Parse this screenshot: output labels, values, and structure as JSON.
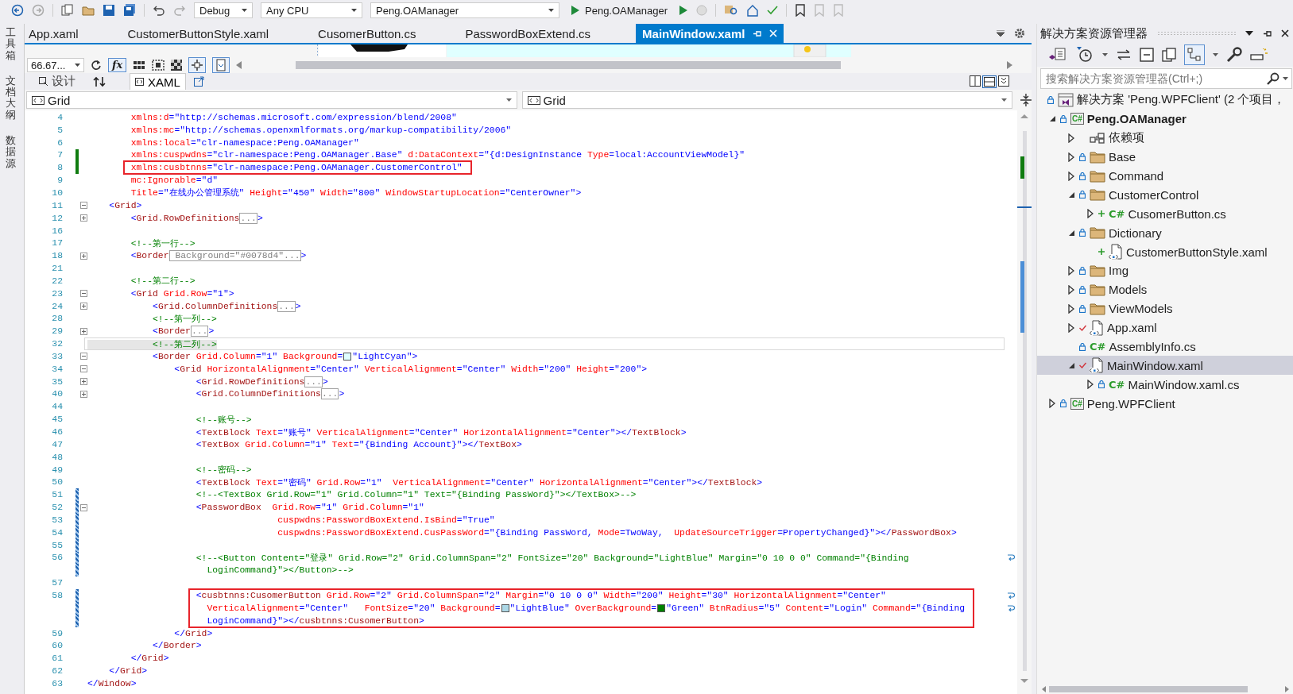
{
  "toolbar": {
    "configuration": "Debug",
    "platform": "Any CPU",
    "startup_project": "Peng.OAManager",
    "run_target": "Peng.OAManager"
  },
  "side_tabs": [
    {
      "label": "工具箱"
    },
    {
      "label": "文档大纲"
    },
    {
      "label": "数据源"
    }
  ],
  "document_tabs": [
    {
      "label": "App.xaml",
      "selected": false
    },
    {
      "label": "CustomerButtonStyle.xaml",
      "selected": false
    },
    {
      "label": "CusomerButton.cs",
      "selected": false
    },
    {
      "label": "PasswordBoxExtend.cs",
      "selected": false
    },
    {
      "label": "MainWindow.xaml",
      "selected": true
    }
  ],
  "designer": {
    "zoom": "66.67...",
    "effects_button": "fx",
    "view_tabs": [
      {
        "label": "设计",
        "selected": false
      },
      {
        "label": "XAML",
        "selected": true
      }
    ],
    "scope_left": "Grid",
    "scope_right": "Grid"
  },
  "code": {
    "rows": [
      {
        "number": "4",
        "tokens": [
          {
            "kind": "attr",
            "text": "        xmlns:d"
          },
          {
            "kind": "val",
            "text": "=\"http://schemas.microsoft.com/expression/blend/2008\""
          }
        ]
      },
      {
        "number": "5",
        "tokens": [
          {
            "kind": "attr",
            "text": "        xmlns:mc"
          },
          {
            "kind": "val",
            "text": "=\"http://schemas.openxmlformats.org/markup-compatibility/2006\""
          }
        ]
      },
      {
        "number": "6",
        "tokens": [
          {
            "kind": "attr",
            "text": "        xmlns:local"
          },
          {
            "kind": "val",
            "text": "=\"clr-namespace:Peng.OAManager\""
          }
        ]
      },
      {
        "number": "7",
        "unsaved_change": true,
        "tokens": [
          {
            "kind": "attr",
            "text": "        xmlns:cuspwdns"
          },
          {
            "kind": "val",
            "text": "=\"clr-namespace:Peng.OAManager.Base\""
          },
          {
            "kind": "attr",
            "text": " d:DataContext"
          },
          {
            "kind": "val",
            "text": "=\"{d:DesignInstance "
          },
          {
            "kind": "attr",
            "text": "Type"
          },
          {
            "kind": "val",
            "text": "=local:AccountViewModel}\""
          }
        ]
      },
      {
        "number": "8",
        "unsaved_change": true,
        "boxed": true,
        "tokens": [
          {
            "kind": "attr",
            "text": "        xmlns:cusbtnns"
          },
          {
            "kind": "val",
            "text": "=\"clr-namespace:Peng.OAManager.CustomerControl\""
          }
        ]
      },
      {
        "number": "9",
        "tokens": [
          {
            "kind": "attr",
            "text": "        mc:Ignorable"
          },
          {
            "kind": "val",
            "text": "=\"d\""
          }
        ]
      },
      {
        "number": "10",
        "tokens": [
          {
            "kind": "attr",
            "text": "        Title"
          },
          {
            "kind": "val",
            "text": "=\"在线办公管理系统\""
          },
          {
            "kind": "attr",
            "text": " Height"
          },
          {
            "kind": "val",
            "text": "=\"450\""
          },
          {
            "kind": "attr",
            "text": " Width"
          },
          {
            "kind": "val",
            "text": "=\"800\""
          },
          {
            "kind": "attr",
            "text": " WindowStartupLocation"
          },
          {
            "kind": "val",
            "text": "=\"CenterOwner\">"
          }
        ]
      },
      {
        "number": "11",
        "folded": false,
        "tokens": [
          {
            "kind": "p",
            "text": "    <"
          },
          {
            "kind": "tag",
            "text": "Grid"
          },
          {
            "kind": "p",
            "text": ">"
          }
        ]
      },
      {
        "number": "12",
        "folded": true,
        "tokens": [
          {
            "kind": "p",
            "text": "        <"
          },
          {
            "kind": "tag",
            "text": "Grid.RowDefinitions"
          },
          {
            "kind": "fold",
            "text": "..."
          },
          {
            "kind": "p",
            "text": ">"
          }
        ]
      },
      {
        "number": "16"
      },
      {
        "number": "17",
        "tokens": [
          {
            "kind": "com",
            "text": "        <!--第一行-->"
          }
        ]
      },
      {
        "number": "18",
        "folded": true,
        "tokens": [
          {
            "kind": "p",
            "text": "        <"
          },
          {
            "kind": "tag",
            "text": "Border"
          },
          {
            "kind": "fold",
            "text": " Background=\"#0078d4\"..."
          },
          {
            "kind": "p",
            "text": ">"
          }
        ]
      },
      {
        "number": "21"
      },
      {
        "number": "22",
        "tokens": [
          {
            "kind": "com",
            "text": "        <!--第二行-->"
          }
        ]
      },
      {
        "number": "23",
        "folded": false,
        "tokens": [
          {
            "kind": "p",
            "text": "        <"
          },
          {
            "kind": "tag",
            "text": "Grid"
          },
          {
            "kind": "attr",
            "text": " Grid.Row"
          },
          {
            "kind": "val",
            "text": "=\"1\">"
          }
        ]
      },
      {
        "number": "24",
        "folded": true,
        "tokens": [
          {
            "kind": "p",
            "text": "            <"
          },
          {
            "kind": "tag",
            "text": "Grid.ColumnDefinitions"
          },
          {
            "kind": "fold",
            "text": "..."
          },
          {
            "kind": "p",
            "text": ">"
          }
        ]
      },
      {
        "number": "28",
        "tokens": [
          {
            "kind": "com",
            "text": "            <!--第一列-->"
          }
        ]
      },
      {
        "number": "29",
        "folded": true,
        "tokens": [
          {
            "kind": "p",
            "text": "            <"
          },
          {
            "kind": "tag",
            "text": "Border"
          },
          {
            "kind": "fold",
            "text": "..."
          },
          {
            "kind": "p",
            "text": ">"
          }
        ]
      },
      {
        "number": "32",
        "current": true,
        "tokens": [
          {
            "kind": "com",
            "text": "            <!--第二列-->"
          }
        ]
      },
      {
        "number": "33",
        "folded": false,
        "tokens": [
          {
            "kind": "p",
            "text": "            <"
          },
          {
            "kind": "tag",
            "text": "Border"
          },
          {
            "kind": "attr",
            "text": " Grid.Column"
          },
          {
            "kind": "val",
            "text": "=\"1\""
          },
          {
            "kind": "attr",
            "text": " Background"
          },
          {
            "kind": "val",
            "text": "="
          },
          {
            "kind": "swatch",
            "color": "#e0ffff"
          },
          {
            "kind": "val",
            "text": "\"LightCyan\">"
          }
        ]
      },
      {
        "number": "34",
        "folded": false,
        "tokens": [
          {
            "kind": "p",
            "text": "                <"
          },
          {
            "kind": "tag",
            "text": "Grid"
          },
          {
            "kind": "attr",
            "text": " HorizontalAlignment"
          },
          {
            "kind": "val",
            "text": "=\"Center\""
          },
          {
            "kind": "attr",
            "text": " VerticalAlignment"
          },
          {
            "kind": "val",
            "text": "=\"Center\""
          },
          {
            "kind": "attr",
            "text": " Width"
          },
          {
            "kind": "val",
            "text": "=\"200\""
          },
          {
            "kind": "attr",
            "text": " Height"
          },
          {
            "kind": "val",
            "text": "=\"200\">"
          }
        ]
      },
      {
        "number": "35",
        "folded": true,
        "tokens": [
          {
            "kind": "p",
            "text": "                    <"
          },
          {
            "kind": "tag",
            "text": "Grid.RowDefinitions"
          },
          {
            "kind": "fold",
            "text": "..."
          },
          {
            "kind": "p",
            "text": ">"
          }
        ]
      },
      {
        "number": "40",
        "folded": true,
        "tokens": [
          {
            "kind": "p",
            "text": "                    <"
          },
          {
            "kind": "tag",
            "text": "Grid.ColumnDefinitions"
          },
          {
            "kind": "fold",
            "text": "..."
          },
          {
            "kind": "p",
            "text": ">"
          }
        ]
      },
      {
        "number": "44"
      },
      {
        "number": "45",
        "tokens": [
          {
            "kind": "com",
            "text": "                    <!--账号-->"
          }
        ]
      },
      {
        "number": "46",
        "tokens": [
          {
            "kind": "p",
            "text": "                    <"
          },
          {
            "kind": "tag",
            "text": "TextBlock"
          },
          {
            "kind": "attr",
            "text": " Text"
          },
          {
            "kind": "val",
            "text": "=\"账号\""
          },
          {
            "kind": "attr",
            "text": " VerticalAlignment"
          },
          {
            "kind": "val",
            "text": "=\"Center\""
          },
          {
            "kind": "attr",
            "text": " HorizontalAlignment"
          },
          {
            "kind": "val",
            "text": "=\"Center\"></"
          },
          {
            "kind": "tag",
            "text": "TextBlock"
          },
          {
            "kind": "p",
            "text": ">"
          }
        ]
      },
      {
        "number": "47",
        "tokens": [
          {
            "kind": "p",
            "text": "                    <"
          },
          {
            "kind": "tag",
            "text": "TextBox"
          },
          {
            "kind": "attr",
            "text": " Grid.Column"
          },
          {
            "kind": "val",
            "text": "=\"1\""
          },
          {
            "kind": "attr",
            "text": " Text"
          },
          {
            "kind": "val",
            "text": "=\"{Binding Account}\"></"
          },
          {
            "kind": "tag",
            "text": "TextBox"
          },
          {
            "kind": "p",
            "text": ">"
          }
        ]
      },
      {
        "number": "48"
      },
      {
        "number": "49",
        "tokens": [
          {
            "kind": "com",
            "text": "                    <!--密码-->"
          }
        ]
      },
      {
        "number": "50",
        "tokens": [
          {
            "kind": "p",
            "text": "                    <"
          },
          {
            "kind": "tag",
            "text": "TextBlock"
          },
          {
            "kind": "attr",
            "text": " Text"
          },
          {
            "kind": "val",
            "text": "=\"密码\""
          },
          {
            "kind": "attr",
            "text": " Grid.Row"
          },
          {
            "kind": "val",
            "text": "=\"1\""
          },
          {
            "kind": "attr",
            "text": "  VerticalAlignment"
          },
          {
            "kind": "val",
            "text": "=\"Center\""
          },
          {
            "kind": "attr",
            "text": " HorizontalAlignment"
          },
          {
            "kind": "val",
            "text": "=\"Center\"></"
          },
          {
            "kind": "tag",
            "text": "TextBlock"
          },
          {
            "kind": "p",
            "text": ">"
          }
        ]
      },
      {
        "number": "51",
        "saved_change": true,
        "tokens": [
          {
            "kind": "com",
            "text": "                    <!--<TextBox Grid.Row=\"1\" Grid.Column=\"1\" Text=\"{Binding PassWord}\"></TextBox>-->"
          }
        ]
      },
      {
        "number": "52",
        "saved_change": true,
        "folded": false,
        "tokens": [
          {
            "kind": "p",
            "text": "                    <"
          },
          {
            "kind": "tag",
            "text": "PasswordBox"
          },
          {
            "kind": "attr",
            "text": "  Grid.Row"
          },
          {
            "kind": "val",
            "text": "=\"1\""
          },
          {
            "kind": "attr",
            "text": " Grid.Column"
          },
          {
            "kind": "val",
            "text": "=\"1\""
          }
        ]
      },
      {
        "number": "53",
        "saved_change": true,
        "tokens": [
          {
            "kind": "attr",
            "text": "                                   cuspwdns:PasswordBoxExtend.IsBind"
          },
          {
            "kind": "val",
            "text": "=\"True\""
          }
        ]
      },
      {
        "number": "54",
        "saved_change": true,
        "tokens": [
          {
            "kind": "attr",
            "text": "                                   cuspwdns:PasswordBoxExtend.CusPassWord"
          },
          {
            "kind": "val",
            "text": "=\"{Binding PassWord,"
          },
          {
            "kind": "attr",
            "text": " Mode"
          },
          {
            "kind": "val",
            "text": "=TwoWay,"
          },
          {
            "kind": "attr",
            "text": "  UpdateSourceTrigger"
          },
          {
            "kind": "val",
            "text": "=PropertyChanged}\"></"
          },
          {
            "kind": "tag",
            "text": "PasswordBox"
          },
          {
            "kind": "p",
            "text": ">"
          }
        ]
      },
      {
        "number": "55",
        "saved_change": true
      },
      {
        "number": "56",
        "saved_change": true,
        "wrap": true,
        "tokens": [
          {
            "kind": "com",
            "text": "                    <!--<Button Content=\"登录\" Grid.Row=\"2\" Grid.ColumnSpan=\"2\" FontSize=\"20\" Background=\"LightBlue\" Margin=\"0 10 0 0\" Command=\"{Binding"
          }
        ]
      },
      {
        "saved_change": true,
        "tokens": [
          {
            "kind": "com",
            "text": "                      LoginCommand}\"></Button>-->"
          }
        ]
      },
      {
        "number": "57"
      },
      {
        "number": "58",
        "saved_change": true,
        "boxed": true,
        "wrap": true,
        "tokens": [
          {
            "kind": "p",
            "text": "                    <"
          },
          {
            "kind": "tag",
            "text": "cusbtnns:CusomerButton"
          },
          {
            "kind": "attr",
            "text": " Grid.Row"
          },
          {
            "kind": "val",
            "text": "=\"2\""
          },
          {
            "kind": "attr",
            "text": " Grid.ColumnSpan"
          },
          {
            "kind": "val",
            "text": "=\"2\""
          },
          {
            "kind": "attr",
            "text": " Margin"
          },
          {
            "kind": "val",
            "text": "=\"0 10 0 0\""
          },
          {
            "kind": "attr",
            "text": " Width"
          },
          {
            "kind": "val",
            "text": "=\"200\""
          },
          {
            "kind": "attr",
            "text": " Height"
          },
          {
            "kind": "val",
            "text": "=\"30\""
          },
          {
            "kind": "attr",
            "text": " HorizontalAlignment"
          },
          {
            "kind": "val",
            "text": "=\"Center\""
          }
        ]
      },
      {
        "saved_change": true,
        "boxed": true,
        "wrap": true,
        "tokens": [
          {
            "kind": "attr",
            "text": "                      VerticalAlignment"
          },
          {
            "kind": "val",
            "text": "=\"Center\""
          },
          {
            "kind": "attr",
            "text": "   FontSize"
          },
          {
            "kind": "val",
            "text": "=\"20\""
          },
          {
            "kind": "attr",
            "text": " Background"
          },
          {
            "kind": "val",
            "text": "="
          },
          {
            "kind": "swatch",
            "color": "#add8e6"
          },
          {
            "kind": "val",
            "text": "\"LightBlue\""
          },
          {
            "kind": "attr",
            "text": " OverBackground"
          },
          {
            "kind": "val",
            "text": "="
          },
          {
            "kind": "swatch",
            "color": "#008000"
          },
          {
            "kind": "val",
            "text": "\"Green\""
          },
          {
            "kind": "attr",
            "text": " BtnRadius"
          },
          {
            "kind": "val",
            "text": "=\"5\""
          },
          {
            "kind": "attr",
            "text": " Content"
          },
          {
            "kind": "val",
            "text": "=\"Login\""
          },
          {
            "kind": "attr",
            "text": " Command"
          },
          {
            "kind": "val",
            "text": "=\"{Binding"
          }
        ]
      },
      {
        "saved_change": true,
        "boxed": true,
        "tokens": [
          {
            "kind": "val",
            "text": "                      LoginCommand}\"></"
          },
          {
            "kind": "tag",
            "text": "cusbtnns:CusomerButton"
          },
          {
            "kind": "p",
            "text": ">"
          }
        ]
      },
      {
        "number": "59",
        "tokens": [
          {
            "kind": "p",
            "text": "                </"
          },
          {
            "kind": "tag",
            "text": "Grid"
          },
          {
            "kind": "p",
            "text": ">"
          }
        ]
      },
      {
        "number": "60",
        "tokens": [
          {
            "kind": "p",
            "text": "            </"
          },
          {
            "kind": "tag",
            "text": "Border"
          },
          {
            "kind": "p",
            "text": ">"
          }
        ]
      },
      {
        "number": "61",
        "tokens": [
          {
            "kind": "p",
            "text": "        </"
          },
          {
            "kind": "tag",
            "text": "Grid"
          },
          {
            "kind": "p",
            "text": ">"
          }
        ]
      },
      {
        "number": "62",
        "tokens": [
          {
            "kind": "p",
            "text": "    </"
          },
          {
            "kind": "tag",
            "text": "Grid"
          },
          {
            "kind": "p",
            "text": ">"
          }
        ]
      },
      {
        "number": "63",
        "tokens": [
          {
            "kind": "p",
            "text": "</"
          },
          {
            "kind": "tag",
            "text": "Window"
          },
          {
            "kind": "p",
            "text": ">"
          }
        ]
      }
    ]
  },
  "solution_explorer": {
    "title": "解决方案资源管理器",
    "search": {
      "placeholder": "搜索解决方案资源管理器(Ctrl+;)"
    },
    "tree": [
      {
        "label": "解决方案 'Peng.WPFClient' (2 个项目，",
        "kind": "solution",
        "locked": true,
        "added": false,
        "checked": false,
        "selected": false,
        "children": [
          {
            "label": "Peng.OAManager",
            "kind": "project",
            "icon_label": "C#",
            "locked": true,
            "added": false,
            "checked": false,
            "expanded": true,
            "selected": false,
            "children": [
              {
                "label": "依赖项",
                "kind": "dependencies",
                "locked": false,
                "added": false,
                "checked": false,
                "expanded": false,
                "selected": false
              },
              {
                "label": "Base",
                "kind": "folder",
                "locked": true,
                "added": false,
                "checked": false,
                "expanded": false,
                "selected": false
              },
              {
                "label": "Command",
                "kind": "folder",
                "locked": true,
                "added": false,
                "checked": false,
                "expanded": false,
                "selected": false
              },
              {
                "label": "CustomerControl",
                "kind": "folder",
                "locked": true,
                "added": false,
                "checked": false,
                "expanded": true,
                "selected": false,
                "children": [
                  {
                    "label": "CusomerButton.cs",
                    "kind": "cs",
                    "icon_label": "C#",
                    "locked": false,
                    "added": true,
                    "checked": false,
                    "expanded": false,
                    "selected": false
                  }
                ]
              },
              {
                "label": "Dictionary",
                "kind": "folder",
                "locked": true,
                "added": false,
                "checked": false,
                "expanded": true,
                "selected": false,
                "children": [
                  {
                    "label": "CustomerButtonStyle.xaml",
                    "kind": "xaml",
                    "locked": false,
                    "added": true,
                    "checked": false,
                    "selected": false
                  }
                ]
              },
              {
                "label": "Img",
                "kind": "folder",
                "locked": true,
                "added": false,
                "checked": false,
                "expanded": false,
                "selected": false
              },
              {
                "label": "Models",
                "kind": "folder",
                "locked": true,
                "added": false,
                "checked": false,
                "expanded": false,
                "selected": false
              },
              {
                "label": "ViewModels",
                "kind": "folder",
                "locked": true,
                "added": false,
                "checked": false,
                "expanded": false,
                "selected": false
              },
              {
                "label": "App.xaml",
                "kind": "xaml",
                "locked": false,
                "added": false,
                "checked": true,
                "expanded": false,
                "selected": false
              },
              {
                "label": "AssemblyInfo.cs",
                "kind": "cs",
                "icon_label": "C#",
                "locked": true,
                "added": false,
                "checked": false,
                "selected": false
              },
              {
                "label": "MainWindow.xaml",
                "kind": "xaml",
                "locked": false,
                "added": false,
                "checked": true,
                "expanded": true,
                "selected": true,
                "children": [
                  {
                    "label": "MainWindow.xaml.cs",
                    "kind": "cs",
                    "icon_label": "C#",
                    "locked": true,
                    "added": false,
                    "checked": false,
                    "expanded": false,
                    "selected": false
                  }
                ]
              }
            ]
          },
          {
            "label": "Peng.WPFClient",
            "kind": "project",
            "icon_label": "C#",
            "locked": true,
            "added": false,
            "checked": false,
            "expanded": false,
            "selected": false
          }
        ]
      }
    ]
  }
}
